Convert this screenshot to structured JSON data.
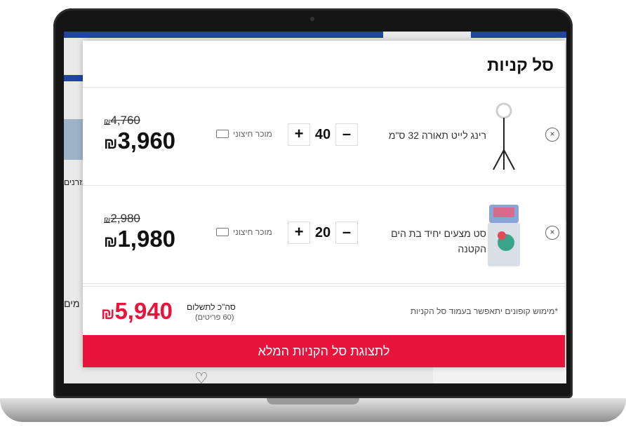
{
  "modal": {
    "title": "סל קניות"
  },
  "items": [
    {
      "name": "רינג לייט תאורה 32 ס\"מ",
      "quantity": "40",
      "minus": "–",
      "plus": "+",
      "seller": "מוכר חיצוני",
      "old_price": "4,760",
      "new_price": "3,960",
      "currency": "₪",
      "remove": "×"
    },
    {
      "name": "סט מצעים יחיד בת הים הקטנה",
      "quantity": "20",
      "minus": "–",
      "plus": "+",
      "seller": "מוכר חיצוני",
      "old_price": "2,980",
      "new_price": "1,980",
      "currency": "₪",
      "remove": "×"
    }
  ],
  "summary": {
    "coupon_note": "*מימוש קופונים יתאפשר בעמוד סל הקניות",
    "total_label": "סה\"כ לתשלום",
    "total_count": "(60 פריטים)",
    "total_price": "5,940",
    "currency": "₪"
  },
  "cta": {
    "label": "לתצוגת סל הקניות המלא"
  },
  "background": {
    "text1": "מזרנים",
    "text2": "מים"
  }
}
